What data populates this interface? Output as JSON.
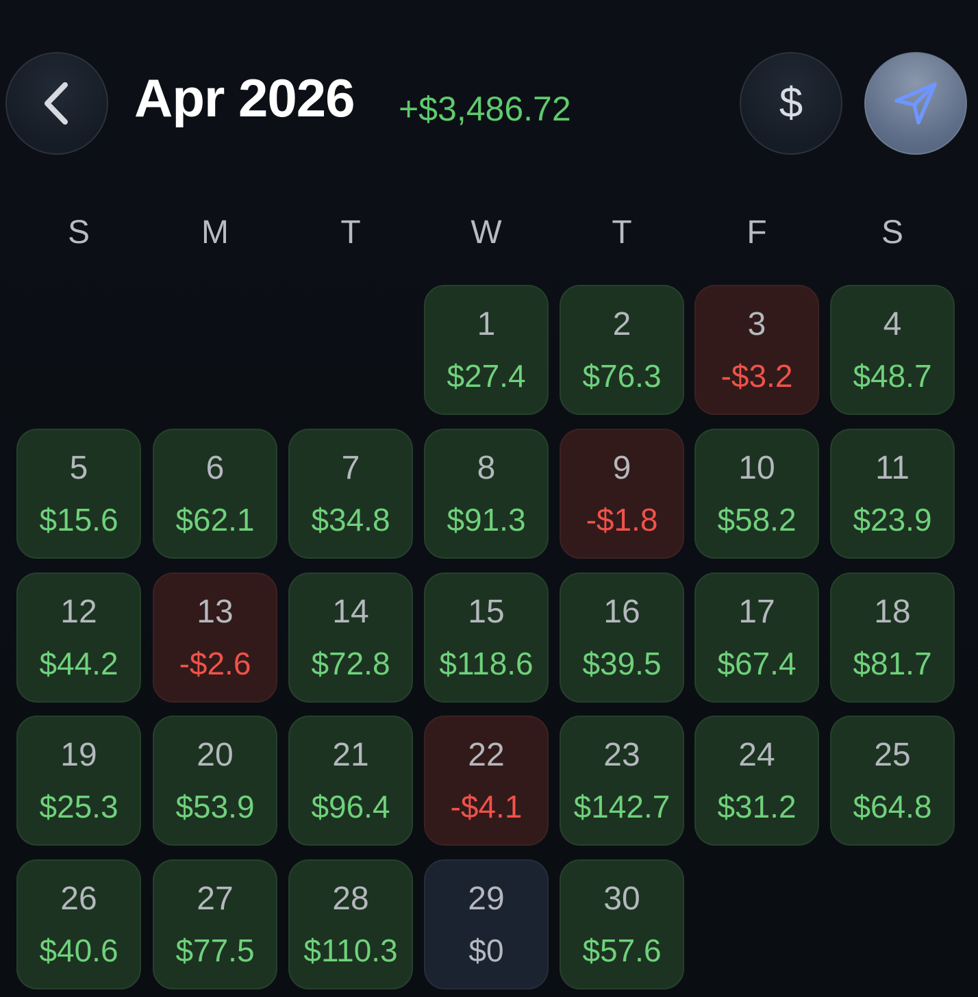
{
  "header": {
    "title": "Apr 2026",
    "total": "+$3,486.72",
    "back_icon": "chevron-left-icon",
    "currency_icon": "dollar-icon",
    "share_icon": "send-icon",
    "dollar_symbol": "$"
  },
  "colors": {
    "positive": "#6fd27b",
    "negative": "#f0524a",
    "positive_cell": "#1d3322",
    "negative_cell": "#321a1a",
    "zero_cell": "#1c2330"
  },
  "weekdays": [
    "S",
    "M",
    "T",
    "W",
    "T",
    "F",
    "S"
  ],
  "days": [
    {
      "day": "1",
      "amount": "$27.4",
      "state": "pos"
    },
    {
      "day": "2",
      "amount": "$76.3",
      "state": "pos"
    },
    {
      "day": "3",
      "amount": "-$3.2",
      "state": "neg"
    },
    {
      "day": "4",
      "amount": "$48.7",
      "state": "pos"
    },
    {
      "day": "5",
      "amount": "$15.6",
      "state": "pos"
    },
    {
      "day": "6",
      "amount": "$62.1",
      "state": "pos"
    },
    {
      "day": "7",
      "amount": "$34.8",
      "state": "pos"
    },
    {
      "day": "8",
      "amount": "$91.3",
      "state": "pos"
    },
    {
      "day": "9",
      "amount": "-$1.8",
      "state": "neg"
    },
    {
      "day": "10",
      "amount": "$58.2",
      "state": "pos"
    },
    {
      "day": "11",
      "amount": "$23.9",
      "state": "pos"
    },
    {
      "day": "12",
      "amount": "$44.2",
      "state": "pos"
    },
    {
      "day": "13",
      "amount": "-$2.6",
      "state": "neg"
    },
    {
      "day": "14",
      "amount": "$72.8",
      "state": "pos"
    },
    {
      "day": "15",
      "amount": "$118.6",
      "state": "pos"
    },
    {
      "day": "16",
      "amount": "$39.5",
      "state": "pos"
    },
    {
      "day": "17",
      "amount": "$67.4",
      "state": "pos"
    },
    {
      "day": "18",
      "amount": "$81.7",
      "state": "pos"
    },
    {
      "day": "19",
      "amount": "$25.3",
      "state": "pos"
    },
    {
      "day": "20",
      "amount": "$53.9",
      "state": "pos"
    },
    {
      "day": "21",
      "amount": "$96.4",
      "state": "pos"
    },
    {
      "day": "22",
      "amount": "-$4.1",
      "state": "neg"
    },
    {
      "day": "23",
      "amount": "$142.7",
      "state": "pos"
    },
    {
      "day": "24",
      "amount": "$31.2",
      "state": "pos"
    },
    {
      "day": "25",
      "amount": "$64.8",
      "state": "pos"
    },
    {
      "day": "26",
      "amount": "$40.6",
      "state": "pos"
    },
    {
      "day": "27",
      "amount": "$77.5",
      "state": "pos"
    },
    {
      "day": "28",
      "amount": "$110.3",
      "state": "pos"
    },
    {
      "day": "29",
      "amount": "$0",
      "state": "zero"
    },
    {
      "day": "30",
      "amount": "$57.6",
      "state": "pos"
    }
  ]
}
